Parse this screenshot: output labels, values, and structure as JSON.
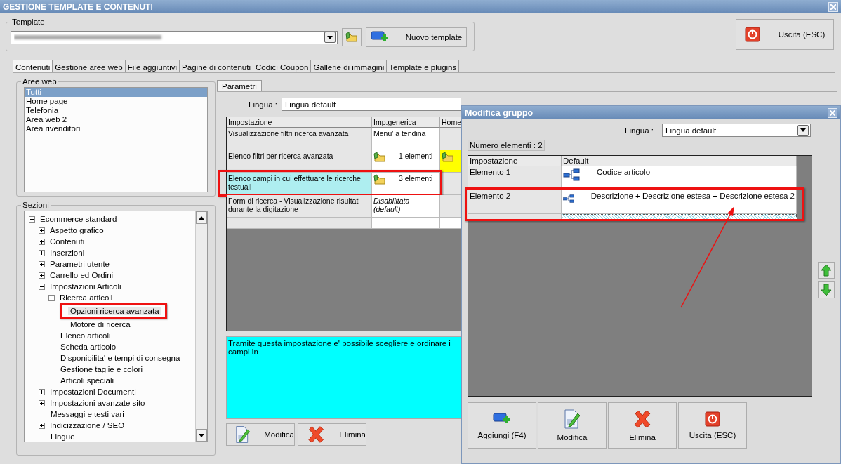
{
  "window": {
    "title": "GESTIONE TEMPLATE E CONTENUTI"
  },
  "template": {
    "label": "Template",
    "new_button": "Nuovo template"
  },
  "exit_button": "Uscita (ESC)",
  "tabs": [
    {
      "label": "Contenuti",
      "selected": true
    },
    {
      "label": "Gestione aree web",
      "selected": false
    },
    {
      "label": "File aggiuntivi",
      "selected": false
    },
    {
      "label": "Pagine di contenuti",
      "selected": false
    },
    {
      "label": "Codici Coupon",
      "selected": false
    },
    {
      "label": "Gallerie di immagini",
      "selected": false
    },
    {
      "label": "Template e plugins",
      "selected": false
    }
  ],
  "aree_web": {
    "title": "Aree web",
    "items": [
      {
        "label": "Tutti",
        "selected": true
      },
      {
        "label": "Home page",
        "selected": false
      },
      {
        "label": "Telefonia",
        "selected": false
      },
      {
        "label": "Area web 2",
        "selected": false
      },
      {
        "label": "Area rivenditori",
        "selected": false
      }
    ]
  },
  "sezioni": {
    "title": "Sezioni",
    "tree": [
      {
        "label": "Ecommerce standard",
        "expanded": true,
        "selected": false,
        "children": [
          {
            "label": "Aspetto grafico",
            "expanded": false,
            "selected": false
          },
          {
            "label": "Contenuti",
            "expanded": false,
            "selected": false
          },
          {
            "label": "Inserzioni",
            "expanded": false,
            "selected": false
          },
          {
            "label": "Parametri utente",
            "expanded": false,
            "selected": false
          },
          {
            "label": "Carrello ed Ordini",
            "expanded": false,
            "selected": false
          },
          {
            "label": "Impostazioni Articoli",
            "expanded": true,
            "selected": false,
            "children": [
              {
                "label": "Ricerca articoli",
                "expanded": true,
                "selected": false,
                "children": [
                  {
                    "label": "Opzioni ricerca avanzata",
                    "selected": true
                  },
                  {
                    "label": "Motore di ricerca",
                    "selected": false
                  }
                ]
              },
              {
                "label": "Elenco articoli",
                "selected": false
              },
              {
                "label": "Scheda articolo",
                "selected": false
              },
              {
                "label": "Disponibilita' e tempi di consegna",
                "selected": false
              },
              {
                "label": "Gestione taglie e colori",
                "selected": false
              },
              {
                "label": "Articoli speciali",
                "selected": false
              }
            ]
          },
          {
            "label": "Impostazioni Documenti",
            "expanded": false,
            "selected": false
          },
          {
            "label": "Impostazioni avanzate sito",
            "expanded": false,
            "selected": false
          },
          {
            "label": "Messaggi e testi vari",
            "selected": false
          },
          {
            "label": "Indicizzazione / SEO",
            "expanded": false,
            "selected": false
          },
          {
            "label": "Lingue",
            "selected": false
          }
        ]
      }
    ]
  },
  "parametri": {
    "tab": "Parametri",
    "lingua_label": "Lingua :",
    "lingua_value": "Lingua default",
    "columns": [
      "Impostazione",
      "Imp.generica",
      "Home"
    ],
    "rows": [
      {
        "setting": "Visualizzazione filtri ricerca avanzata",
        "value": "Menu' a tendina",
        "kind": "text",
        "selected": false,
        "home_override": false
      },
      {
        "setting": "Elenco filtri per ricerca avanzata",
        "value": "1 elementi",
        "kind": "list",
        "selected": false,
        "home_override": true
      },
      {
        "setting": "Elenco campi in cui effettuare le ricerche testuali",
        "value": "3 elementi",
        "kind": "list",
        "selected": true,
        "home_override": false
      },
      {
        "setting": "Form di ricerca - Visualizzazione risultati durante la digitazione",
        "value": "Disabilitata (default)",
        "kind": "default",
        "selected": false,
        "home_override": false
      }
    ],
    "description": "Tramite questa impostazione e' possibile scegliere e ordinare i campi in",
    "buttons": [
      {
        "label": "Modifica",
        "kind": "edit"
      },
      {
        "label": "Elimina",
        "kind": "delete"
      }
    ]
  },
  "dialog": {
    "title": "Modifica gruppo",
    "lingua_label": "Lingua :",
    "lingua_value": "Lingua default",
    "count": "Numero elementi : 2",
    "columns": [
      "Impostazione",
      "Default"
    ],
    "rows": [
      {
        "name": "Elemento 1",
        "value": "Codice articolo"
      },
      {
        "name": "Elemento 2",
        "value": "Descrizione + Descrizione estesa + Descrizione estesa 2"
      }
    ],
    "buttons": [
      {
        "label": "Aggiungi (F4)",
        "kind": "add"
      },
      {
        "label": "Modifica",
        "kind": "edit"
      },
      {
        "label": "Elimina",
        "kind": "delete"
      },
      {
        "label": "Uscita (ESC)",
        "kind": "exit"
      }
    ]
  }
}
